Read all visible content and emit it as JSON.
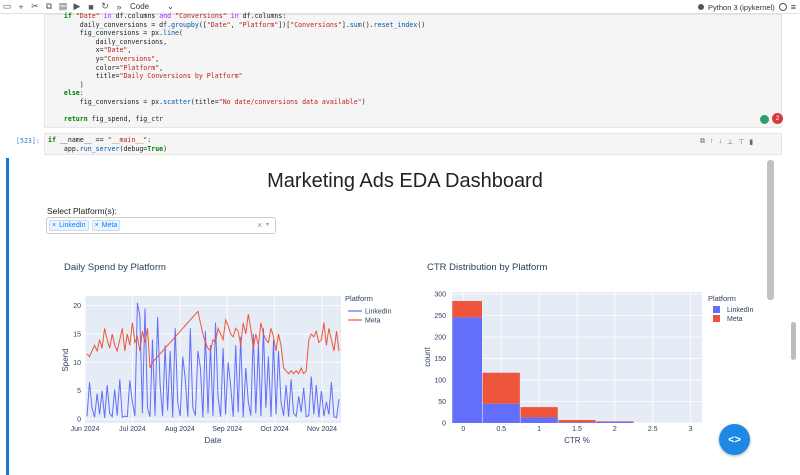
{
  "toolbar": {
    "cell_type": "Code",
    "cell_type_chevron": "⌄",
    "kernel": "Python 3 (ipykernel)"
  },
  "cell1": {
    "lines": [
      "    if \"Date\" in df.columns and \"Conversions\" in df.columns:",
      "        daily_conversions = df.groupby([\"Date\", \"Platform\"])[\"Conversions\"].sum().reset_index()",
      "        fig_conversions = px.line(",
      "            daily_conversions,",
      "            x=\"Date\",",
      "            y=\"Conversions\",",
      "            color=\"Platform\",",
      "            title=\"Daily Conversions by Platform\"",
      "        )",
      "    else:",
      "        fig_conversions = px.scatter(title=\"No date/conversions data available\")",
      "",
      "    return fig_spend, fig_ctr"
    ],
    "badge_count": "2"
  },
  "cell2": {
    "prompt": "[523]:",
    "lines": [
      "if __name__ == \"__main__\":",
      "    app.run_server(debug=True)"
    ]
  },
  "dashboard": {
    "title": "Marketing Ads EDA Dashboard",
    "select_label": "Select Platform(s):",
    "chips": [
      "LinkedIn",
      "Meta"
    ],
    "clear_symbol": "×",
    "arrow_symbol": "▾"
  },
  "colors": {
    "linkedin": "#636efa",
    "meta": "#ef553b",
    "plot_bg": "#e5ecf6",
    "accent": "#1e88e5"
  },
  "chart_data": [
    {
      "type": "line",
      "title": "Daily Spend by Platform",
      "xlabel": "Date",
      "ylabel": "Spend",
      "x_ticks": [
        "Jun 2024",
        "Jul 2024",
        "Aug 2024",
        "Sep 2024",
        "Oct 2024",
        "Nov 2024"
      ],
      "y_ticks": [
        0,
        5,
        10,
        15,
        20
      ],
      "ylim": [
        0,
        21
      ],
      "legend_title": "Platform",
      "legend_position": "right",
      "grid": true,
      "series": [
        {
          "name": "LinkedIn",
          "values": [
            0.5,
            6.5,
            2,
            0.3,
            4.5,
            0.8,
            5,
            0.2,
            6,
            1,
            0.4,
            5.2,
            0.6,
            7,
            0.3,
            0.5,
            0.4,
            6.8,
            3,
            0.5,
            20.5,
            18,
            1,
            19.5,
            2,
            0.4,
            14,
            0.6,
            18,
            6,
            0.5,
            13,
            1.5,
            12,
            0.3,
            16,
            3,
            0.5,
            11,
            7,
            0.4,
            16,
            2,
            0.6,
            12,
            9,
            0.3,
            15.5,
            1,
            13,
            0.5,
            17,
            4,
            0.4,
            12.5,
            0.8,
            10,
            6,
            0.4,
            13,
            1.2,
            14.5,
            0.3,
            9,
            3,
            0.6,
            15,
            1,
            13,
            0.5,
            16,
            2,
            11,
            0.4,
            14,
            0.8,
            12,
            3,
            0.6,
            6,
            0.4,
            7,
            1,
            0.5,
            4,
            1.2,
            5.5,
            0.4,
            0.6,
            7.5,
            0.8,
            6,
            0.3,
            5,
            0.5,
            3,
            0.8,
            6.5,
            0.4,
            0.2,
            3.5
          ]
        },
        {
          "name": "Meta",
          "values": [
            11.5,
            11,
            12,
            13,
            12,
            14,
            12.5,
            16,
            14,
            12.5,
            15,
            13,
            12,
            14,
            16,
            12,
            15,
            13,
            17,
            13.5,
            14.5,
            12,
            15.5,
            13.5,
            16,
            9,
            10,
            10.5,
            11,
            11.5,
            12,
            12.5,
            13,
            13.5,
            14,
            14.5,
            15,
            15.5,
            16,
            16.5,
            17,
            17.5,
            18,
            18.5,
            19,
            17,
            15,
            13.5,
            12.5,
            12,
            14,
            13.5,
            16,
            15,
            14,
            17.5,
            16.5,
            15,
            14.5,
            16,
            15.5,
            13,
            17,
            15,
            18.5,
            16,
            12.5,
            15,
            13,
            17,
            15,
            14,
            13.5,
            16,
            14.5,
            12,
            15,
            13,
            9,
            8.5,
            8,
            8.5,
            8,
            8.5,
            8,
            9,
            8,
            8.5,
            14,
            15,
            14.5,
            15.5,
            13.5,
            14,
            17,
            13,
            16,
            14,
            12,
            15.5,
            12
          ]
        }
      ]
    },
    {
      "type": "bar",
      "title": "CTR Distribution by Platform",
      "xlabel": "CTR %",
      "ylabel": "count",
      "x_ticks": [
        "0",
        "0.5",
        "1",
        "1.5",
        "2",
        "2.5",
        "3"
      ],
      "y_ticks": [
        0,
        50,
        100,
        150,
        200,
        250,
        300
      ],
      "xlim": [
        -0.15,
        3.15
      ],
      "ylim": [
        0,
        305
      ],
      "stacked": true,
      "legend_title": "Platform",
      "legend_position": "right",
      "grid": true,
      "bin_edges": [
        -0.15,
        0.25,
        0.75,
        1.25,
        1.75,
        2.25
      ],
      "series": [
        {
          "name": "LinkedIn",
          "values": [
            246,
            45,
            13,
            2,
            3
          ]
        },
        {
          "name": "Meta",
          "values": [
            38,
            72,
            24,
            5,
            1
          ]
        }
      ]
    }
  ]
}
